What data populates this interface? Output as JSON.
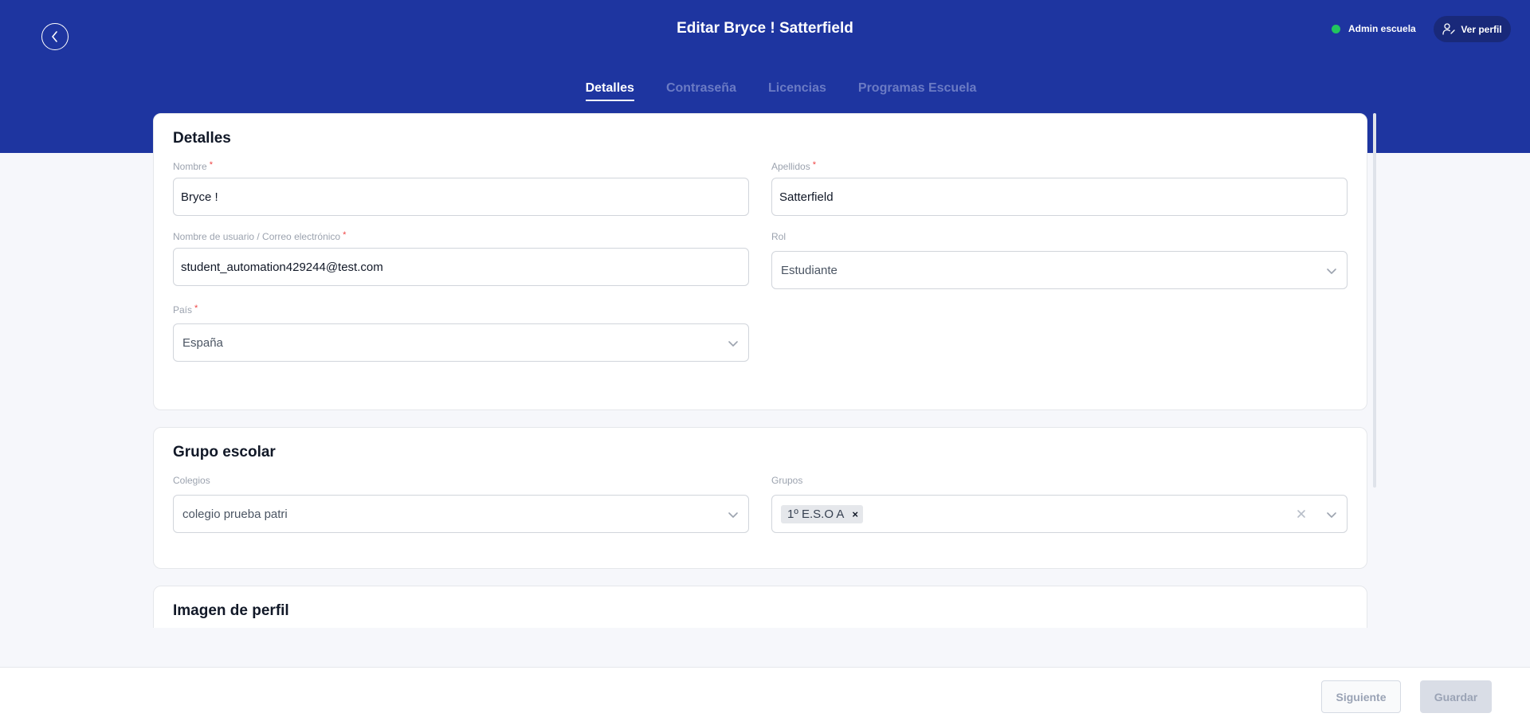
{
  "header": {
    "title": "Editar Bryce ! Satterfield",
    "status_label": "Admin escuela",
    "profile_button": "Ver perfil",
    "icons": {
      "back": "chevron-left-icon",
      "profile": "user-edit-icon"
    },
    "colors": {
      "header": "#1e35a0",
      "status_dot": "#22c55e"
    }
  },
  "tabs": [
    "Detalles",
    "Contraseña",
    "Licencias",
    "Programas Escuela"
  ],
  "details": {
    "title": "Detalles",
    "nombre": {
      "label": "Nombre",
      "value": "Bryce !"
    },
    "apellidos": {
      "label": "Apellidos",
      "value": "Satterfield"
    },
    "usuario": {
      "label": "Nombre de usuario / Correo electrónico",
      "value": "student_automation429244@test.com"
    },
    "rol": {
      "label": "Rol",
      "value": "Estudiante"
    },
    "pais": {
      "label": "País",
      "value": "España"
    },
    "required_mark": "*"
  },
  "school_group": {
    "title": "Grupo escolar",
    "colegios": {
      "label": "Colegios",
      "value": "colegio prueba patri"
    },
    "grupos": {
      "label": "Grupos",
      "chips": [
        "1º E.S.O A"
      ],
      "chip_remove": "×"
    }
  },
  "profile_image": {
    "title": "Imagen de perfil"
  },
  "footer": {
    "next": "Siguiente",
    "save": "Guardar"
  }
}
